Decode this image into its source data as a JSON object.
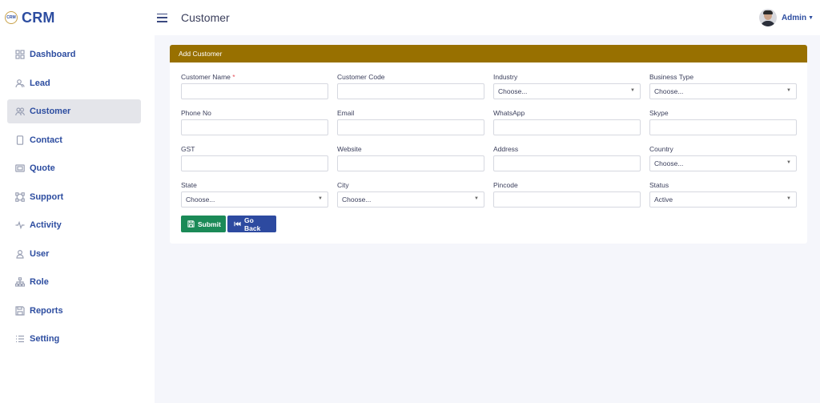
{
  "brand": {
    "logo_text": "CRM",
    "name": "CRM"
  },
  "sidebar": {
    "items": [
      {
        "label": "Dashboard",
        "icon": "grid-icon"
      },
      {
        "label": "Lead",
        "icon": "users-icon"
      },
      {
        "label": "Customer",
        "icon": "users-group-icon",
        "active": true
      },
      {
        "label": "Contact",
        "icon": "phone-icon"
      },
      {
        "label": "Quote",
        "icon": "card-icon"
      },
      {
        "label": "Support",
        "icon": "frame-icon"
      },
      {
        "label": "Activity",
        "icon": "activity-icon"
      },
      {
        "label": "User",
        "icon": "user-icon"
      },
      {
        "label": "Role",
        "icon": "hierarchy-icon"
      },
      {
        "label": "Reports",
        "icon": "save-icon"
      },
      {
        "label": "Setting",
        "icon": "list-icon"
      }
    ]
  },
  "header": {
    "title": "Customer",
    "user_name": "Admin"
  },
  "card": {
    "title": "Add Customer"
  },
  "form": {
    "customer_name": {
      "label": "Customer Name",
      "required_mark": "*",
      "value": ""
    },
    "customer_code": {
      "label": "Customer Code",
      "value": ""
    },
    "industry": {
      "label": "Industry",
      "selected": "Choose..."
    },
    "business_type": {
      "label": "Business Type",
      "selected": "Choose..."
    },
    "phone_no": {
      "label": "Phone No",
      "value": ""
    },
    "email": {
      "label": "Email",
      "value": ""
    },
    "whatsapp": {
      "label": "WhatsApp",
      "value": ""
    },
    "skype": {
      "label": "Skype",
      "value": ""
    },
    "gst": {
      "label": "GST",
      "value": ""
    },
    "website": {
      "label": "Website",
      "value": ""
    },
    "address": {
      "label": "Address",
      "value": ""
    },
    "country": {
      "label": "Country",
      "selected": "Choose..."
    },
    "state": {
      "label": "State",
      "selected": "Choose..."
    },
    "city": {
      "label": "City",
      "selected": "Choose..."
    },
    "pincode": {
      "label": "Pincode",
      "value": ""
    },
    "status": {
      "label": "Status",
      "selected": "Active"
    }
  },
  "buttons": {
    "submit": "Submit",
    "go_back": "Go Back"
  },
  "colors": {
    "accent": "#2d4da0",
    "card_header": "#987000",
    "submit": "#1b8a57",
    "back": "#2d4aa0",
    "required": "#e7515a"
  }
}
